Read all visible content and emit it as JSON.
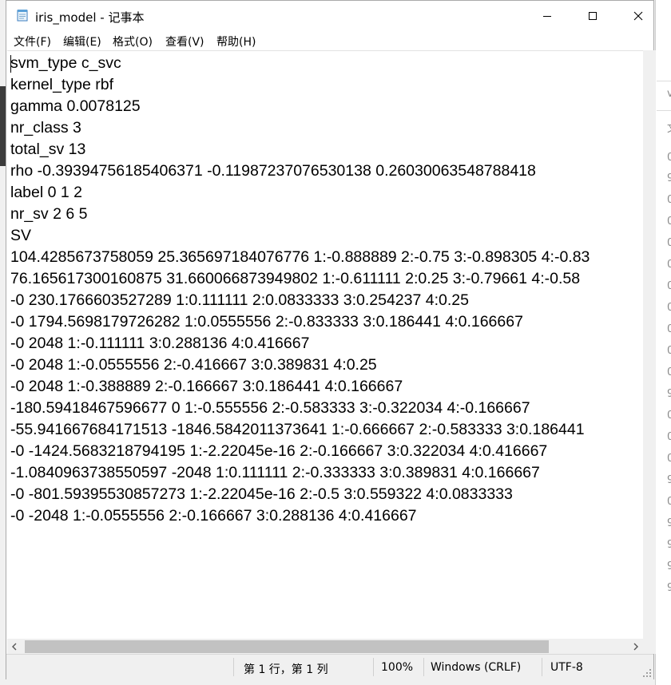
{
  "window": {
    "title": "iris_model - 记事本"
  },
  "menu": [
    "文件(F)",
    "编辑(E)",
    "格式(O)",
    "查看(V)",
    "帮助(H)"
  ],
  "document": {
    "lines": [
      "svm_type c_svc",
      "kernel_type rbf",
      "gamma 0.0078125",
      "nr_class 3",
      "total_sv 13",
      "rho -0.39394756185406371 -0.11987237076530138 0.26030063548788418",
      "label 0 1 2",
      "nr_sv 2 6 5",
      "SV",
      "104.4285673758059 25.365697184076776 1:-0.888889 2:-0.75 3:-0.898305 4:-0.83",
      "76.165617300160875 31.660066873949802 1:-0.611111 2:0.25 3:-0.79661 4:-0.58",
      "-0 230.1766603527289 1:0.111111 2:0.0833333 3:0.254237 4:0.25",
      "-0 1794.5698179726282 1:0.0555556 2:-0.833333 3:0.186441 4:0.166667",
      "-0 2048 1:-0.111111 3:0.288136 4:0.416667",
      "-0 2048 1:-0.0555556 2:-0.416667 3:0.389831 4:0.25",
      "-0 2048 1:-0.388889 2:-0.166667 3:0.186441 4:0.166667",
      "-180.59418467596677 0 1:-0.555556 2:-0.583333 3:-0.322034 4:-0.166667",
      "-55.941667684171513 -1846.5842011373641 1:-0.666667 2:-0.583333 3:0.186441",
      "-0 -1424.5683218794195 1:-2.22045e-16 2:-0.166667 3:0.322034 4:0.416667",
      "-1.0840963738550597 -2048 1:0.111111 2:-0.333333 3:0.389831 4:0.166667",
      "-0 -801.59395530857273 1:-2.22045e-16 2:-0.5 3:0.559322 4:0.0833333",
      "-0 -2048 1:-0.0555556 2:-0.166667 3:0.288136 4:0.416667"
    ]
  },
  "status": {
    "position": "第 1 行，第 1 列",
    "zoom": "100%",
    "line_ending": "Windows (CRLF)",
    "encoding": "UTF-8"
  },
  "background_window": {
    "fragments": [
      "v",
      "文",
      "0",
      "9",
      "0",
      "0",
      "0",
      "0",
      "0",
      "0",
      "0",
      "0",
      "0",
      "9",
      "0",
      "0",
      "0",
      "9",
      "0",
      "9",
      "9",
      "9",
      "9"
    ]
  }
}
